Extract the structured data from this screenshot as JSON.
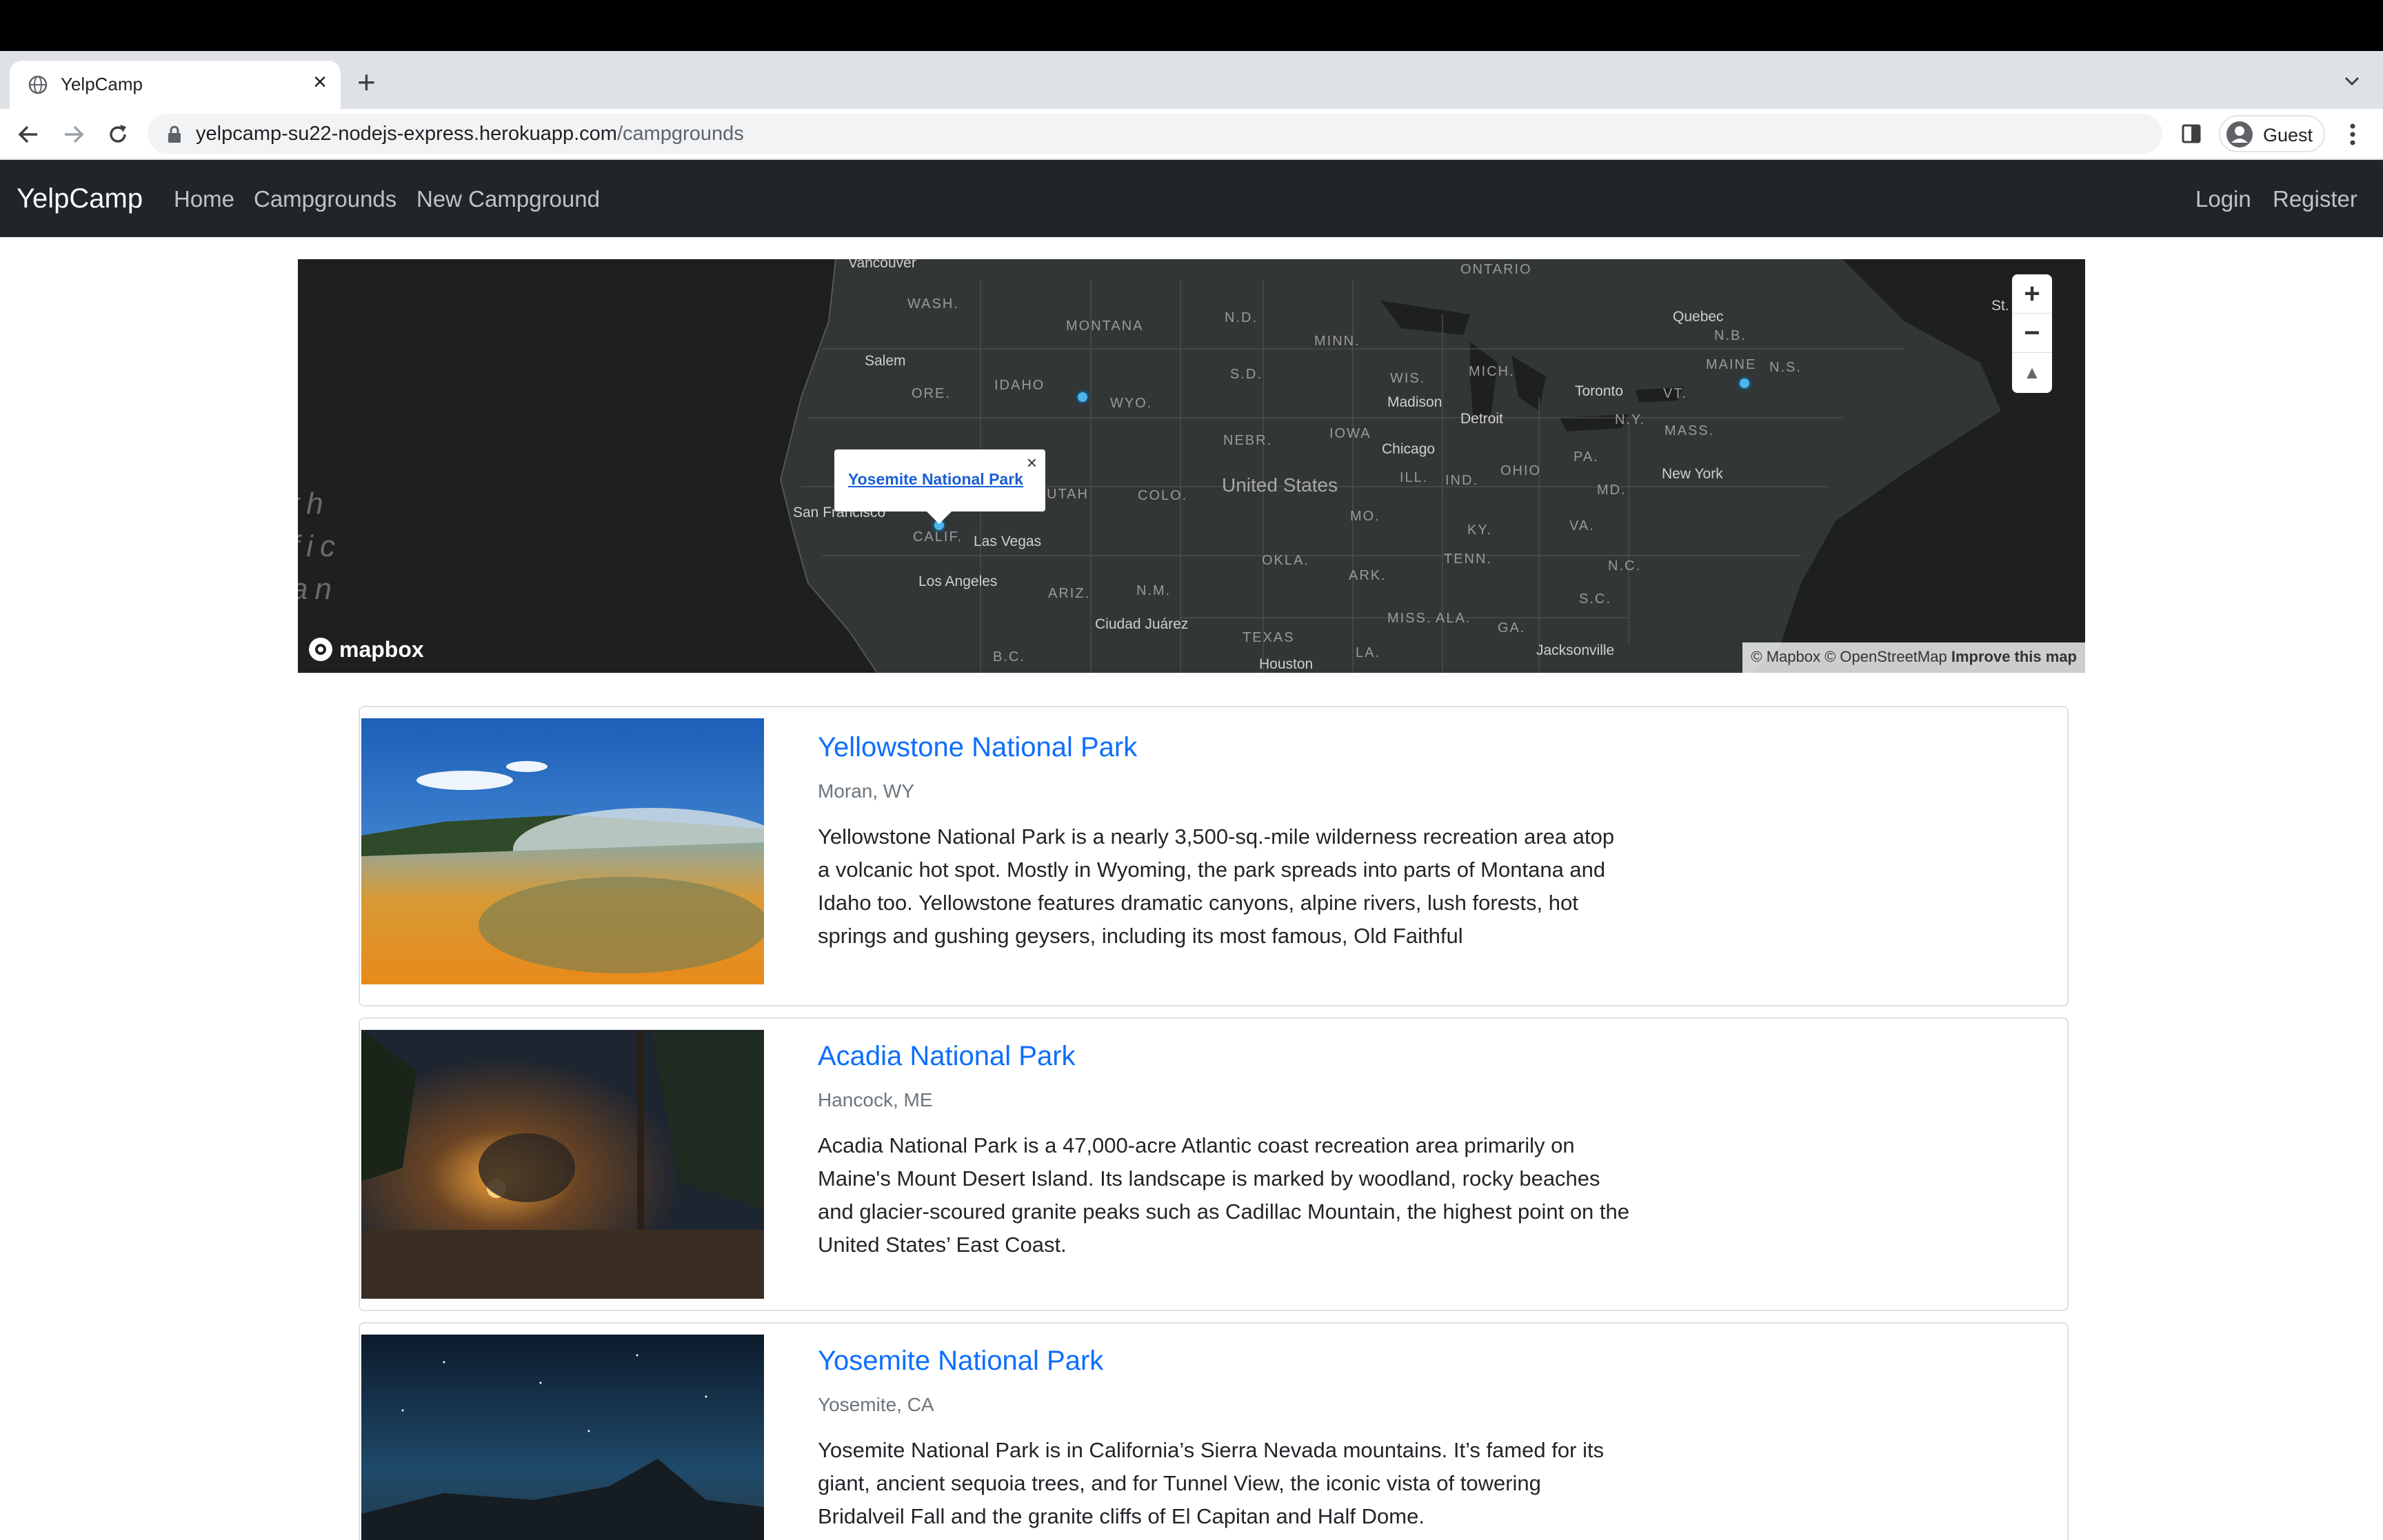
{
  "browser": {
    "tab_title": "YelpCamp",
    "url_host": "yelpcamp-su22-nodejs-express.herokuapp.com",
    "url_path": "/campgrounds",
    "profile_label": "Guest"
  },
  "navbar": {
    "brand": "YelpCamp",
    "links": [
      "Home",
      "Campgrounds",
      "New Campground"
    ],
    "right_links": [
      "Login",
      "Register"
    ]
  },
  "map": {
    "country_label": "United States",
    "ocean_label_lines": [
      "th",
      "fic",
      "an"
    ],
    "region_labels": [
      "WASH.",
      "MONTANA",
      "N.D.",
      "MINN.",
      "ONTARIO",
      "ORE.",
      "IDAHO",
      "WYO.",
      "S.D.",
      "WIS.",
      "MICH.",
      "N.B.",
      "MAINE",
      "N.S.",
      "VT.",
      "N.Y.",
      "MASS.",
      "NEBR.",
      "IOWA",
      "PA.",
      "UTAH",
      "COLO.",
      "ILL.",
      "IND.",
      "OHIO",
      "MD.",
      "CALIF.",
      "MO.",
      "KY.",
      "VA.",
      "OKLA.",
      "TENN.",
      "N.C.",
      "ARIZ.",
      "N.M.",
      "ARK.",
      "S.C.",
      "MISS.",
      "ALA.",
      "GA.",
      "TEXAS",
      "LA.",
      "B.C."
    ],
    "city_labels": [
      "Vancouver",
      "Salem",
      "Quebec",
      "St. Jo",
      "Madison",
      "Toronto",
      "Detroit",
      "Chicago",
      "New York",
      "San Francisco",
      "Las Vegas",
      "Los Angeles",
      "Ciudad Juárez",
      "Houston",
      "Jacksonville"
    ],
    "popup_link": "Yosemite National Park",
    "popup_close": "×",
    "zoom_in": "+",
    "zoom_out": "−",
    "compass": "▲",
    "logo_text": "mapbox",
    "attribution": "© Mapbox © OpenStreetMap",
    "improve_link": "Improve this map",
    "marker_color": "#4fb4ea"
  },
  "campgrounds": [
    {
      "title": "Yellowstone National Park",
      "location": "Moran, WY",
      "description": "Yellowstone National Park is a nearly 3,500-sq.-mile wilderness recreation area atop a volcanic hot spot. Mostly in Wyoming, the park spreads into parts of Montana and Idaho too. Yellowstone features dramatic canyons, alpine rivers, lush forests, hot springs and gushing geysers, including its most famous, Old Faithful"
    },
    {
      "title": "Acadia National Park",
      "location": "Hancock, ME",
      "description": "Acadia National Park is a 47,000-acre Atlantic coast recreation area primarily on Maine's Mount Desert Island. Its landscape is marked by woodland, rocky beaches and glacier-scoured granite peaks such as Cadillac Mountain, the highest point on the United States’ East Coast."
    },
    {
      "title": "Yosemite National Park",
      "location": "Yosemite, CA",
      "description": "Yosemite National Park is in California’s Sierra Nevada mountains. It’s famed for its giant, ancient sequoia trees, and for Tunnel View, the iconic vista of towering Bridalveil Fall and the granite cliffs of El Capitan and Half Dome."
    }
  ],
  "colors": {
    "navbar_bg": "#212529",
    "link_blue": "#0d6efd",
    "map_bg": "#1d1f20"
  }
}
